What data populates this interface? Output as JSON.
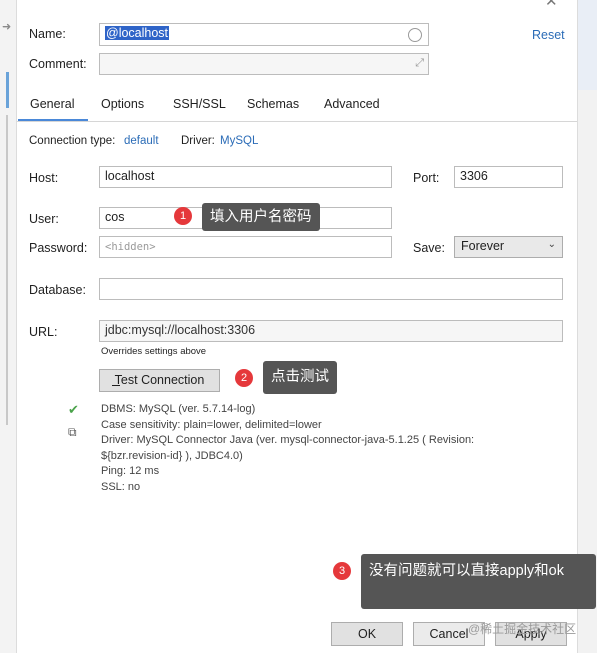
{
  "form": {
    "name_label": "Name:",
    "name_value": "@localhost",
    "reset_link": "Reset",
    "comment_label": "Comment:",
    "comment_value": ""
  },
  "tabs": [
    {
      "label": "General",
      "active": true
    },
    {
      "label": "Options"
    },
    {
      "label": "SSH/SSL"
    },
    {
      "label": "Schemas"
    },
    {
      "label": "Advanced"
    }
  ],
  "connection": {
    "type_label": "Connection type:",
    "type_value": "default",
    "driver_label": "Driver:",
    "driver_value": "MySQL"
  },
  "fields": {
    "host_label": "Host:",
    "host_value": "localhost",
    "port_label": "Port:",
    "port_value": "3306",
    "user_label": "User:",
    "user_value": "cos",
    "password_label": "Password:",
    "password_placeholder": "<hidden>",
    "save_label": "Save:",
    "save_value": "Forever",
    "database_label": "Database:",
    "database_value": "",
    "url_label": "URL:",
    "url_value": "jdbc:mysql://localhost:3306",
    "url_note": "Overrides settings above"
  },
  "test_button_label": "Test Connection",
  "test_result": [
    "DBMS: MySQL (ver. 5.7.14-log)",
    "Case sensitivity: plain=lower, delimited=lower",
    "Driver: MySQL Connector Java (ver. mysql-connector-java-5.1.25 ( Revision:",
    "${bzr.revision-id} ), JDBC4.0)",
    "Ping: 12 ms",
    "SSL: no"
  ],
  "callouts": [
    {
      "number": "1",
      "text": "填入用户名密码"
    },
    {
      "number": "2",
      "text": "点击测试"
    },
    {
      "number": "3",
      "text": "没有问题就可以直接apply和ok"
    }
  ],
  "buttons": {
    "ok": "OK",
    "cancel": "Cancel",
    "apply": "Apply"
  },
  "watermark": "@稀土掘金技术社区",
  "colors": {
    "link": "#2b6cb7",
    "tab_underline": "#4a88d8",
    "callout_bg": "#555555",
    "badge_red": "#e5383b",
    "success_green": "#4aa24a"
  },
  "icons": [
    "close-icon",
    "clear-circle-icon",
    "expand-icon",
    "check-icon",
    "copy-icon",
    "chevron-down-icon",
    "arrow-icon"
  ]
}
